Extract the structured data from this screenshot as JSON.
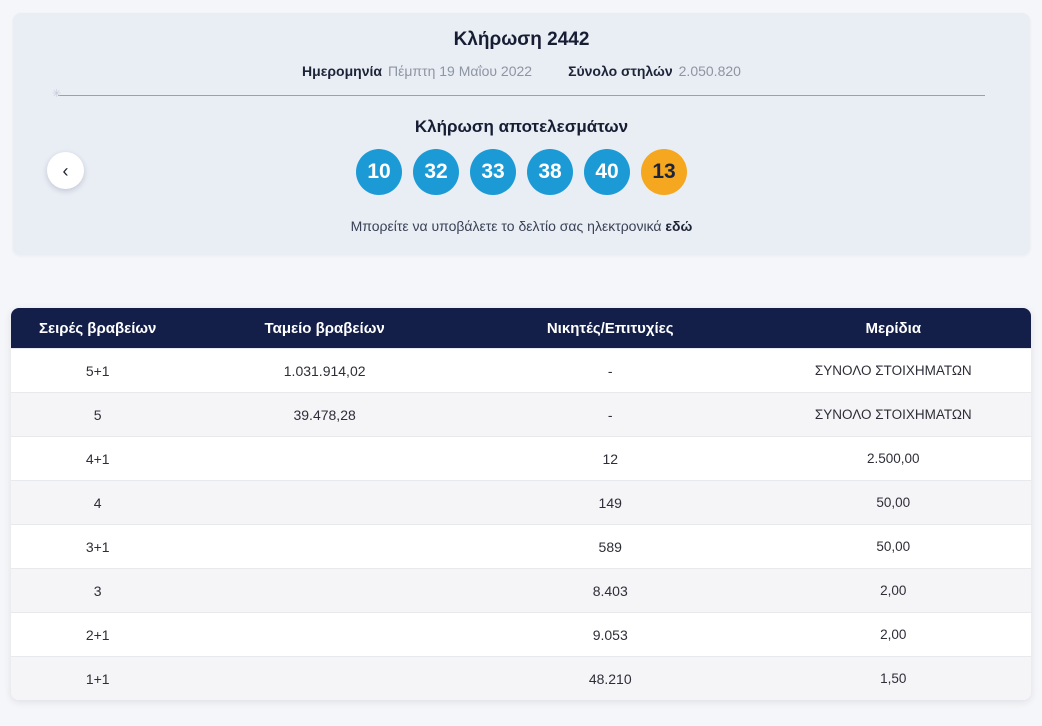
{
  "colors": {
    "ball_blue": "#1b9ad6",
    "ball_orange": "#f5a71f",
    "header_navy": "#131f49",
    "card_background": "#e9edf4"
  },
  "draw_card": {
    "title": "Κλήρωση 2442",
    "date_label": "Ημερομηνία",
    "date_value": "Πέμπτη 19 Μαΐου 2022",
    "total_columns_label": "Σύνολο στηλών",
    "total_columns_value": "2.050.820",
    "results_heading": "Κλήρωση αποτελεσμάτων",
    "numbers": [
      "10",
      "32",
      "33",
      "38",
      "40"
    ],
    "joker_number": "13",
    "submit_text": "Μπορείτε να υποβάλετε το δελτίο σας ηλεκτρονικά",
    "submit_link_label": "εδώ",
    "prev_button_glyph": "‹"
  },
  "prizes_table": {
    "headers": {
      "tier": "Σειρές βραβείων",
      "fund": "Ταμείο βραβείων",
      "winners": "Νικητές/Επιτυχίες",
      "share": "Μερίδια"
    },
    "rows": [
      {
        "tier": "5+1",
        "fund": "1.031.914,02",
        "winners": "-",
        "share": "ΣΥΝΟΛΟ ΣΤΟΙΧΗΜΑΤΩΝ"
      },
      {
        "tier": "5",
        "fund": "39.478,28",
        "winners": "-",
        "share": "ΣΥΝΟΛΟ ΣΤΟΙΧΗΜΑΤΩΝ"
      },
      {
        "tier": "4+1",
        "fund": "",
        "winners": "12",
        "share": "2.500,00"
      },
      {
        "tier": "4",
        "fund": "",
        "winners": "149",
        "share": "50,00"
      },
      {
        "tier": "3+1",
        "fund": "",
        "winners": "589",
        "share": "50,00"
      },
      {
        "tier": "3",
        "fund": "",
        "winners": "8.403",
        "share": "2,00"
      },
      {
        "tier": "2+1",
        "fund": "",
        "winners": "9.053",
        "share": "2,00"
      },
      {
        "tier": "1+1",
        "fund": "",
        "winners": "48.210",
        "share": "1,50"
      }
    ]
  }
}
